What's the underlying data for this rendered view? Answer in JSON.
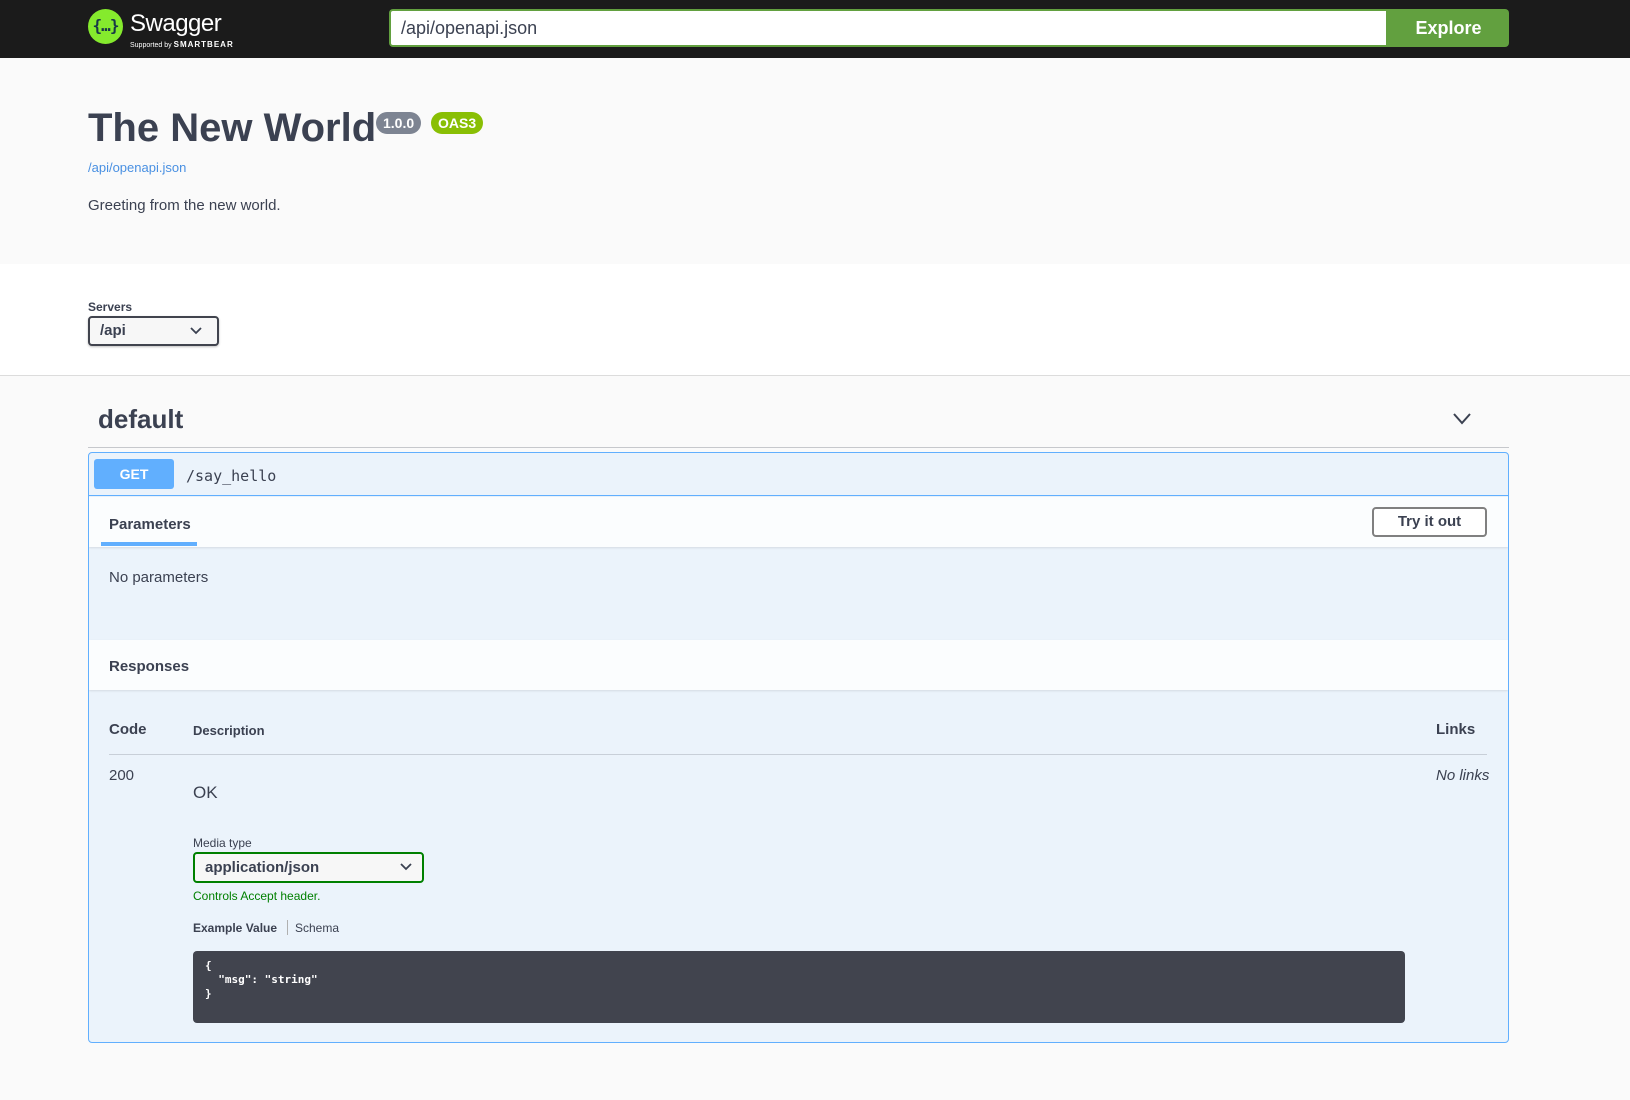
{
  "topbar": {
    "logo_name": "Swagger",
    "logo_sub_prefix": "Supported by",
    "logo_sub_brand": "SMARTBEAR",
    "url_value": "/api/openapi.json",
    "explore_label": "Explore",
    "accent_color": "#62a03f"
  },
  "info": {
    "title": "The New World",
    "version": "1.0.0",
    "oas_badge": "OAS3",
    "spec_link": "/api/openapi.json",
    "description": "Greeting from the new world."
  },
  "servers": {
    "label": "Servers",
    "selected": "/api"
  },
  "tag": {
    "name": "default",
    "expanded": true
  },
  "operation": {
    "method": "GET",
    "path": "/say_hello",
    "method_color": "#61affe",
    "parameters_tab": "Parameters",
    "try_label": "Try it out",
    "no_params": "No parameters",
    "responses_title": "Responses",
    "columns": {
      "code": "Code",
      "description": "Description",
      "links": "Links"
    },
    "responses": [
      {
        "code": "200",
        "description": "OK",
        "links": "No links",
        "media_type_label": "Media type",
        "media_type": "application/json",
        "media_hint": "Controls Accept header.",
        "tab_example": "Example Value",
        "tab_schema": "Schema",
        "example": "{\n  \"msg\": \"string\"\n}"
      }
    ]
  }
}
